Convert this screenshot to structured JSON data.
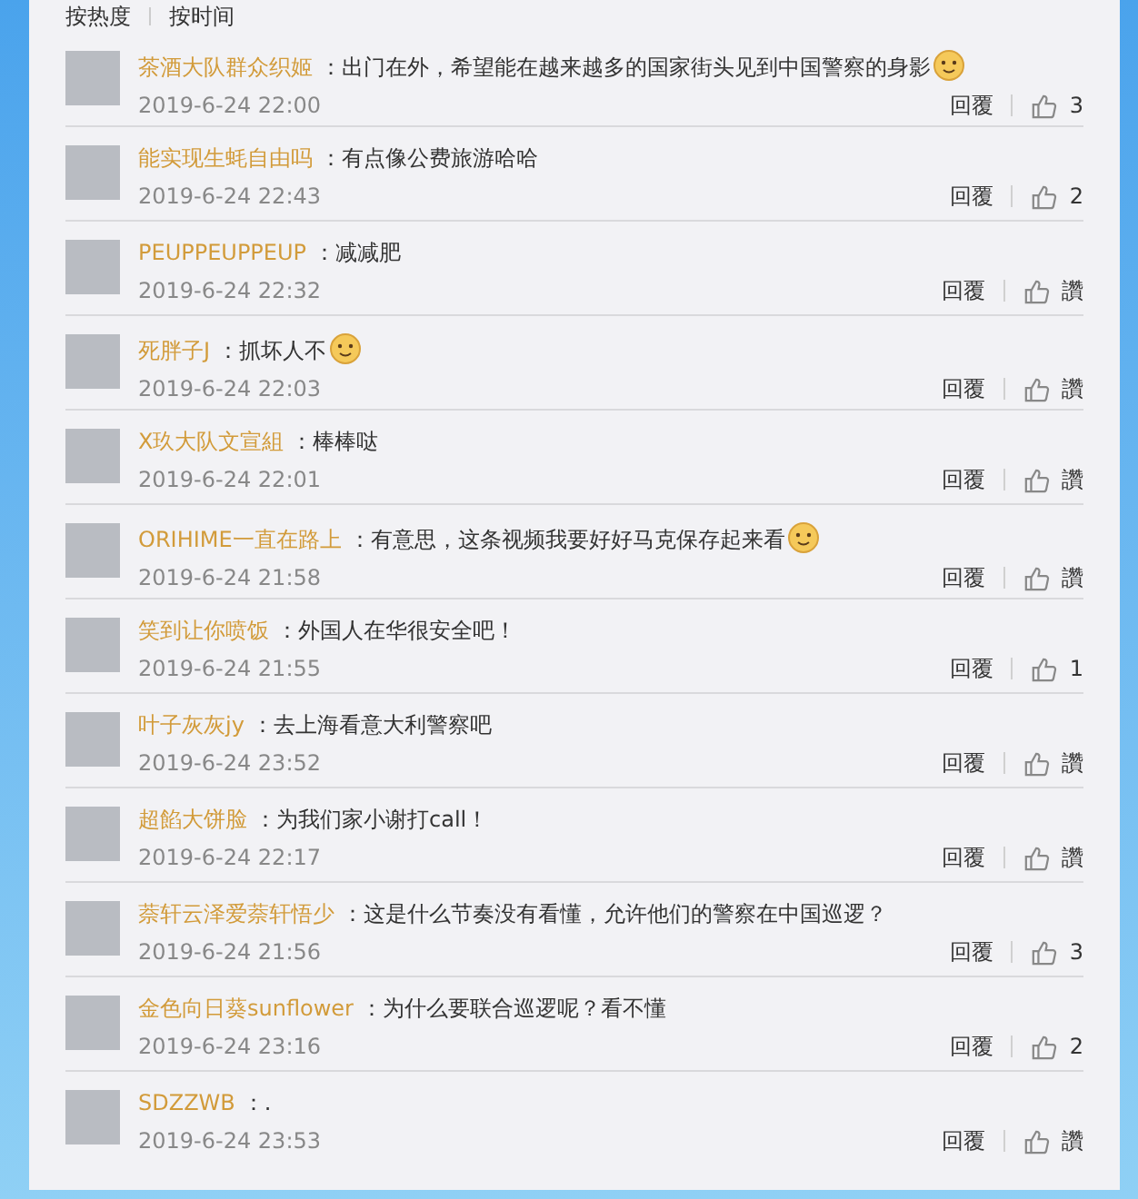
{
  "sort_tabs": [
    {
      "label": "按热度"
    },
    {
      "label": "按时间"
    }
  ],
  "comments": [
    {
      "user": "茶酒大队群众织姬",
      "text": "：出门在外，希望能在越来越多的国家街头见到中国警察的身影",
      "emoji": true,
      "time": "2019-6-24 22:00",
      "reply": "回覆",
      "likes": "3"
    },
    {
      "user": "能实现生蚝自由吗",
      "text": "：有点像公费旅游哈哈",
      "emoji": false,
      "time": "2019-6-24 22:43",
      "reply": "回覆",
      "likes": "2"
    },
    {
      "user": "PEUPPEUPPEUP",
      "text": "：减减肥",
      "emoji": false,
      "time": "2019-6-24 22:32",
      "reply": "回覆",
      "likes": "讚"
    },
    {
      "user": "死胖子J",
      "text": "：抓坏人不",
      "emoji": true,
      "time": "2019-6-24 22:03",
      "reply": "回覆",
      "likes": "讚"
    },
    {
      "user": "X玖大队文宣組",
      "text": "：棒棒哒",
      "emoji": false,
      "time": "2019-6-24 22:01",
      "reply": "回覆",
      "likes": "讚"
    },
    {
      "user": "ORIHIME一直在路上",
      "text": "：有意思，这条视频我要好好马克保存起来看",
      "emoji": true,
      "time": "2019-6-24 21:58",
      "reply": "回覆",
      "likes": "讚"
    },
    {
      "user": "笑到让你喷饭",
      "text": "：外国人在华很安全吧！",
      "emoji": false,
      "time": "2019-6-24 21:55",
      "reply": "回覆",
      "likes": "1"
    },
    {
      "user": "叶子灰灰jy",
      "text": "：去上海看意大利警察吧",
      "emoji": false,
      "time": "2019-6-24 23:52",
      "reply": "回覆",
      "likes": "讚"
    },
    {
      "user": "超餡大饼脸",
      "text": "：为我们家小谢打call！",
      "emoji": false,
      "time": "2019-6-24 22:17",
      "reply": "回覆",
      "likes": "讚"
    },
    {
      "user": "萘轩云泽爱萘轩悟少",
      "text": "：这是什么节奏没有看懂，允许他们的警察在中国巡逻？",
      "emoji": false,
      "time": "2019-6-24 21:56",
      "reply": "回覆",
      "likes": "3"
    },
    {
      "user": "金色向日葵sunflower",
      "text": "：为什么要联合巡逻呢？看不懂",
      "emoji": false,
      "time": "2019-6-24 23:16",
      "reply": "回覆",
      "likes": "2"
    },
    {
      "user": "SDZZWB",
      "text": "：.",
      "emoji": false,
      "time": "2019-6-24 23:53",
      "reply": "回覆",
      "likes": "讚"
    }
  ]
}
